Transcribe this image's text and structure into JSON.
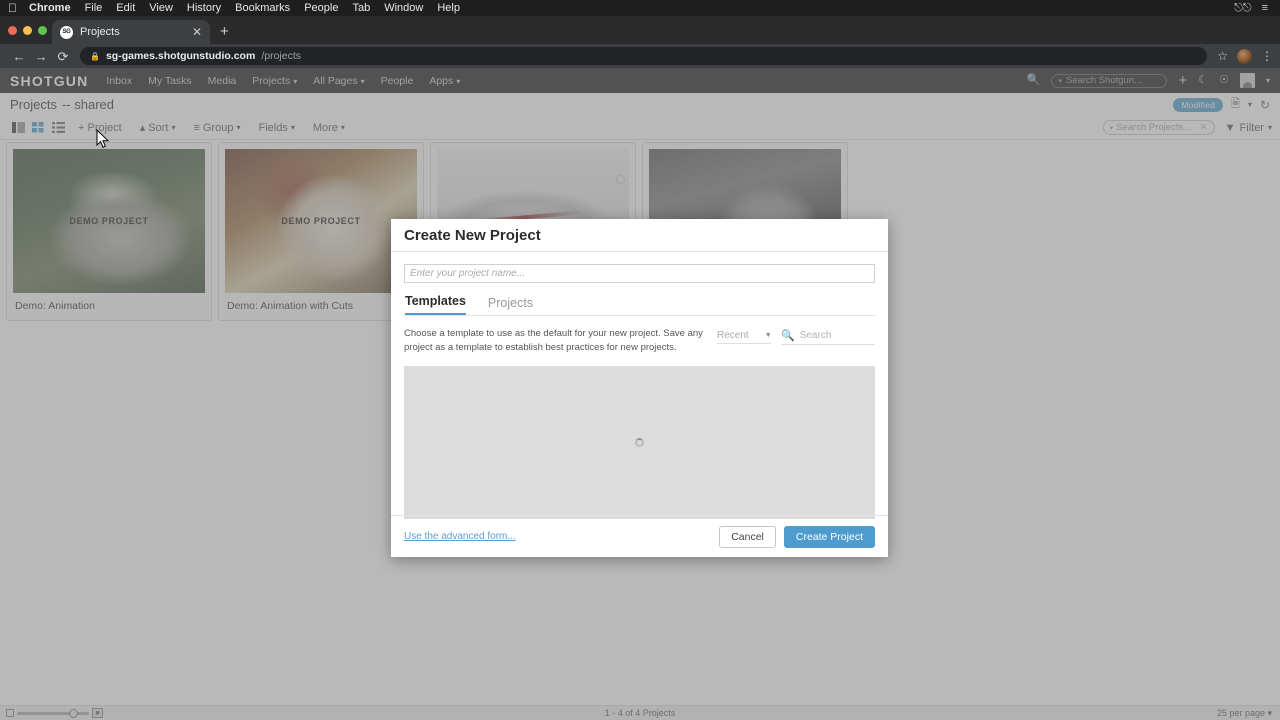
{
  "os_menu": {
    "apple_icon": "apple-icon",
    "items": [
      "Chrome",
      "File",
      "Edit",
      "View",
      "History",
      "Bookmarks",
      "People",
      "Tab",
      "Window",
      "Help"
    ],
    "right_icons": [
      "control-center-icon",
      "list-icon"
    ]
  },
  "browser": {
    "tab": {
      "favicon_text": "SG",
      "title": "Projects",
      "close_icon": "close-icon"
    },
    "new_tab_icon": "plus-icon",
    "nav": {
      "back_icon": "back-arrow-icon",
      "forward_icon": "forward-arrow-icon",
      "reload_icon": "reload-icon"
    },
    "address": {
      "lock_icon": "lock-icon",
      "host": "sg-games.shotgunstudio.com",
      "path": "/projects"
    },
    "toolbar_right": {
      "bookmark_icon": "star-icon",
      "profile_icon": "avatar-icon",
      "menu_icon": "kebab-menu-icon"
    }
  },
  "app": {
    "logo": "SHOTGUN",
    "nav": [
      {
        "label": "Inbox",
        "caret": false
      },
      {
        "label": "My Tasks",
        "caret": false
      },
      {
        "label": "Media",
        "caret": false
      },
      {
        "label": "Projects",
        "caret": true
      },
      {
        "label": "All Pages",
        "caret": true
      },
      {
        "label": "People",
        "caret": false
      },
      {
        "label": "Apps",
        "caret": true
      }
    ],
    "header_right": {
      "search_icon": "search-icon",
      "search_placeholder": "Search Shotgun...",
      "add_icon": "plus-icon",
      "theme_icon": "moon-icon",
      "help_icon": "help-circle-icon",
      "avatar": "avatar-icon",
      "avatar_caret": "chevron-down-icon"
    },
    "page_title": "Projects",
    "page_subtitle": "-- shared",
    "title_right": {
      "badge": "Modified",
      "page_icon": "page-icon",
      "page_caret": "chevron-down-icon",
      "refresh_icon": "refresh-icon"
    },
    "toolbar": {
      "view_icons": [
        "detail-view-icon",
        "grid-view-icon",
        "list-view-icon"
      ],
      "active_view": "grid-view-icon",
      "items": [
        {
          "label": "+ Project",
          "caret": false
        },
        {
          "label": "Sort",
          "caret": true
        },
        {
          "label": "Group",
          "caret": true
        },
        {
          "label": "Fields",
          "caret": true
        },
        {
          "label": "More",
          "caret": true
        }
      ],
      "search_placeholder": "Search Projects...",
      "search_clear_icon": "clear-icon",
      "filter_label": "Filter",
      "filter_icon": "funnel-icon"
    },
    "cards": [
      {
        "name": "Demo: Animation",
        "overlay_text": "DEMO PROJECT",
        "theme": "t1"
      },
      {
        "name": "Demo: Animation with Cuts",
        "overlay_text": "DEMO PROJECT",
        "theme": "t2"
      },
      {
        "name": "",
        "overlay_text": "",
        "theme": "t3"
      },
      {
        "name": "",
        "overlay_text": "",
        "theme": "t4"
      }
    ],
    "statusbar": {
      "zoom_small_icon": "small-thumbnail-icon",
      "zoom_large_icon": "large-thumbnail-icon",
      "count_text": "1 - 4 of 4 Projects",
      "per_page_text": "25 per page"
    }
  },
  "modal": {
    "title": "Create New Project",
    "name_placeholder": "Enter your project name...",
    "name_value": "",
    "tabs": [
      {
        "label": "Templates",
        "active": true
      },
      {
        "label": "Projects",
        "active": false
      }
    ],
    "help_text": "Choose a template to use as the default for your new project. Save any project as a template to establish best practices for new projects.",
    "sort_value": "Recent",
    "sort_caret": "chevron-down-icon",
    "search_icon": "search-icon",
    "search_placeholder": "Search",
    "loading_icon": "spinner-icon",
    "advanced_link": "Use the advanced form...",
    "cancel_label": "Cancel",
    "create_label": "Create Project"
  },
  "colors": {
    "accent": "#4d9ccd",
    "link": "#5b9ed0",
    "header_dark": "#1b1b1b",
    "chrome_dark": "#3c4043"
  }
}
